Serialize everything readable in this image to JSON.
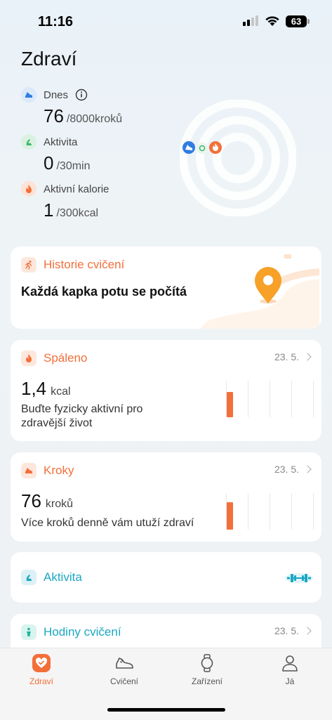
{
  "status": {
    "time": "11:16",
    "battery": "63"
  },
  "page_title": "Zdraví",
  "summary": {
    "steps": {
      "label": "Dnes",
      "value": "76",
      "goal": "/8000kroků"
    },
    "activity": {
      "label": "Aktivita",
      "value": "0",
      "goal": "/30min"
    },
    "calories": {
      "label": "Aktivní kalorie",
      "value": "1",
      "goal": "/300kcal"
    }
  },
  "cards": {
    "history": {
      "title": "Historie cvičení",
      "subtitle": "Každá kapka potu se počítá"
    },
    "burned": {
      "title": "Spáleno",
      "date": "23. 5.",
      "value": "1,4",
      "unit": "kcal",
      "desc_line1": "Buďte fyzicky aktivní pro",
      "desc_line2": "zdravější život",
      "progress": 0.7
    },
    "steps": {
      "title": "Kroky",
      "date": "23. 5.",
      "value": "76",
      "unit": "kroků",
      "desc": "Více kroků denně vám utuží zdraví",
      "progress": 0.75
    },
    "activity": {
      "title": "Aktivita"
    },
    "exercise_hours": {
      "title": "Hodiny cvičení",
      "date": "23. 5."
    }
  },
  "tabs": [
    {
      "label": "Zdraví",
      "active": true
    },
    {
      "label": "Cvičení",
      "active": false
    },
    {
      "label": "Zařízení",
      "active": false
    },
    {
      "label": "Já",
      "active": false
    }
  ],
  "colors": {
    "accent": "#f36f3a",
    "blue": "#2f7de1",
    "green": "#3fb96a",
    "teal": "#1aa7c2"
  }
}
